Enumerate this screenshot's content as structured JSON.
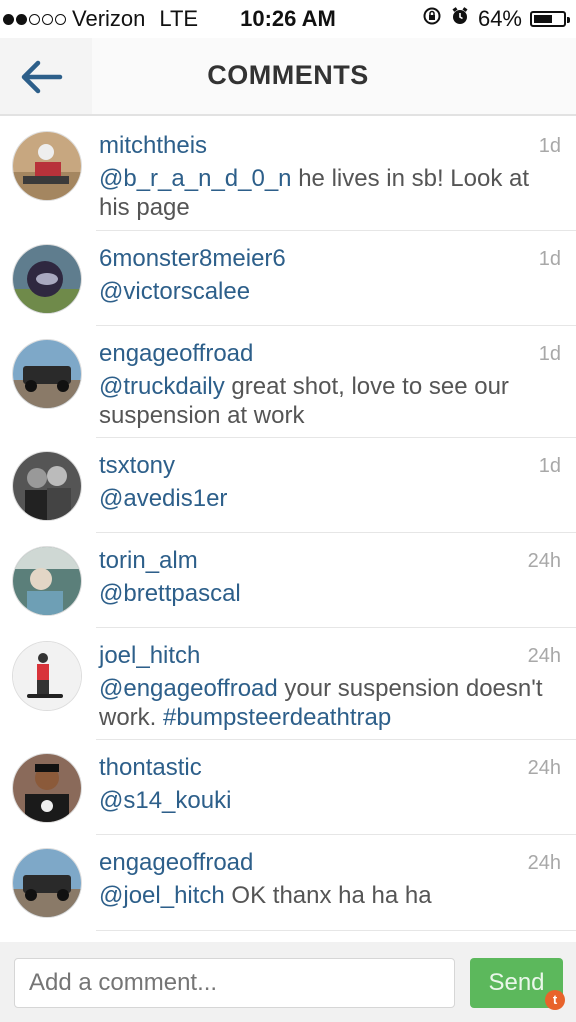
{
  "status_bar": {
    "carrier": "Verizon",
    "network": "LTE",
    "time": "10:26 AM",
    "battery_percent": "64%",
    "battery_level": 0.64,
    "signal_bars_filled": 2,
    "signal_bars_total": 5,
    "icons": [
      "rotation-lock-icon",
      "alarm-icon",
      "battery-icon"
    ]
  },
  "header": {
    "title": "COMMENTS",
    "back_icon": "back-arrow-icon"
  },
  "comments": [
    {
      "username": "mitchtheis",
      "time": "1d",
      "mention": "@b_r_a_n_d_0_n",
      "text": " he lives in sb! Look at his page"
    },
    {
      "username": "6monster8meier6",
      "time": "1d",
      "mention": "@victorscalee",
      "text": ""
    },
    {
      "username": "engageoffroad",
      "time": "1d",
      "mention": "@truckdaily",
      "text": " great shot, love to see our suspension at work"
    },
    {
      "username": "tsxtony",
      "time": "1d",
      "mention": "@avedis1er",
      "text": ""
    },
    {
      "username": "torin_alm",
      "time": "24h",
      "mention": "@brettpascal",
      "text": ""
    },
    {
      "username": "joel_hitch",
      "time": "24h",
      "mention": "@engageoffroad",
      "text": " your suspension doesn't work. ",
      "hashtag": "#bumpsteerdeathtrap"
    },
    {
      "username": "thontastic",
      "time": "24h",
      "mention": "@s14_kouki",
      "text": ""
    },
    {
      "username": "engageoffroad",
      "time": "24h",
      "mention": "@joel_hitch",
      "text": " OK thanx ha ha ha"
    }
  ],
  "composer": {
    "placeholder": "Add a comment...",
    "send_label": "Send",
    "badge": "t"
  },
  "colors": {
    "link": "#2d5f8a",
    "send_button": "#5cb85c",
    "badge": "#e8632b"
  }
}
